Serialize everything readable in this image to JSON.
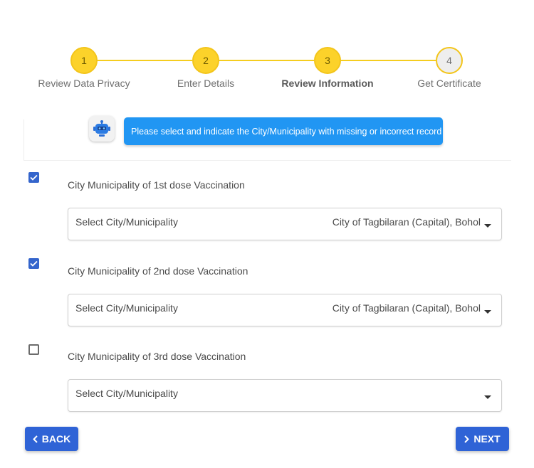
{
  "stepper": {
    "steps": [
      {
        "number": "1",
        "label": "Review Data Privacy"
      },
      {
        "number": "2",
        "label": "Enter Details"
      },
      {
        "number": "3",
        "label": "Review Information"
      },
      {
        "number": "4",
        "label": "Get Certificate"
      }
    ],
    "active_step": 3
  },
  "assistant": {
    "icon": "robot-icon",
    "message": "Please select and indicate the City/Municipality with missing or incorrect record"
  },
  "doses": [
    {
      "label": "City Municipality of 1st dose Vaccination",
      "checked": true,
      "placeholder": "Select City/Municipality",
      "value": "City of Tagbilaran (Capital), Bohol"
    },
    {
      "label": "City Municipality of 2nd dose Vaccination",
      "checked": true,
      "placeholder": "Select City/Municipality",
      "value": "City of Tagbilaran (Capital), Bohol"
    },
    {
      "label": "City Municipality of 3rd dose Vaccination",
      "checked": false,
      "placeholder": "Select City/Municipality",
      "value": ""
    }
  ],
  "buttons": {
    "back": "BACK",
    "next": "NEXT"
  },
  "colors": {
    "step_accent": "#fcd22a",
    "message_bg": "#2196f3",
    "button_bg": "#2f63d6",
    "checkbox_checked": "#3465cc"
  }
}
